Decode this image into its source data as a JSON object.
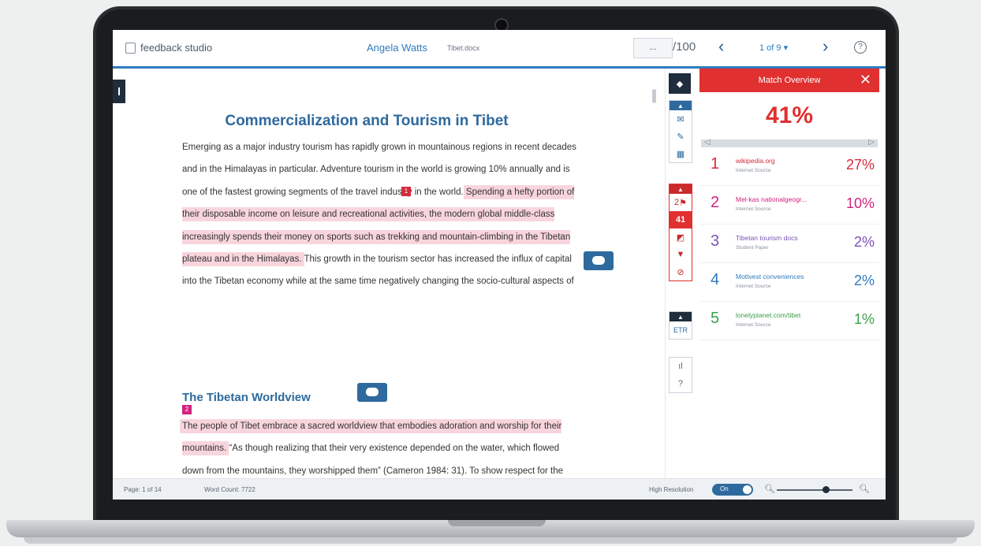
{
  "header": {
    "app_name": "feedback studio",
    "student_name": "Angela Watts",
    "student_sub": "Tibet.docx",
    "score_value": "--",
    "score_total": "/100",
    "pager": "1 of 9 ▾"
  },
  "document": {
    "title": "Commercialization and Tourism in Tibet",
    "para1_a": "Emerging as a major industry tourism has rapidly grown in mountainous regions in recent decades and in the Himalayas in particular. Adventure tourism in the world is growing 10% annually and is one of the fastest growing segments of the travel industry in the world.",
    "para1_hl": "Spending a hefty portion of their disposable income on leisure and recreational activities, the modern global middle-class increasingly spends their money on sports such as trekking and mountain-climbing in the Tibetan plateau and in the Himalayas.",
    "para1_b": "This growth in the tourism sector has increased the influx of capital into the Tibetan economy while at the same time negatively changing the socio-cultural aspects of",
    "marker1": "1",
    "heading2": "The Tibetan Worldview",
    "marker2": "2",
    "para2_hl": "The people of Tibet embrace a sacred worldview that embodies adoration and worship for their mountains.",
    "para2_b": "“As though realizing that their very existence depended on the water, which flowed down from the mountains, they worshipped them” (Cameron 1984: 31). To show respect for the mountains,"
  },
  "tools": {
    "similarity_count": "41",
    "flags_count": "2"
  },
  "match_panel": {
    "title": "Match Overview",
    "overall": "41%",
    "matches": [
      {
        "num": "1",
        "source": "wikipedia.org",
        "type": "Internet Source",
        "pct": "27%",
        "color": "#d62a3a"
      },
      {
        "num": "2",
        "source": "Mel-kas nationalgeogr...",
        "type": "Internet Source",
        "pct": "10%",
        "color": "#d1237f"
      },
      {
        "num": "3",
        "source": "Tibetan tourism docs",
        "type": "Student Paper",
        "pct": "2%",
        "color": "#7a52b5"
      },
      {
        "num": "4",
        "source": "Mottvest conveniences",
        "type": "Internet Source",
        "pct": "2%",
        "color": "#2f7bbf"
      },
      {
        "num": "5",
        "source": "lonelyplanet.com/tibet",
        "type": "Internet Source",
        "pct": "1%",
        "color": "#3aa14a"
      }
    ]
  },
  "status": {
    "page": "Page: 1 of 14",
    "word_count": "Word Count: 7722",
    "high_resolution": "High Resolution",
    "toggle_label": "On"
  }
}
